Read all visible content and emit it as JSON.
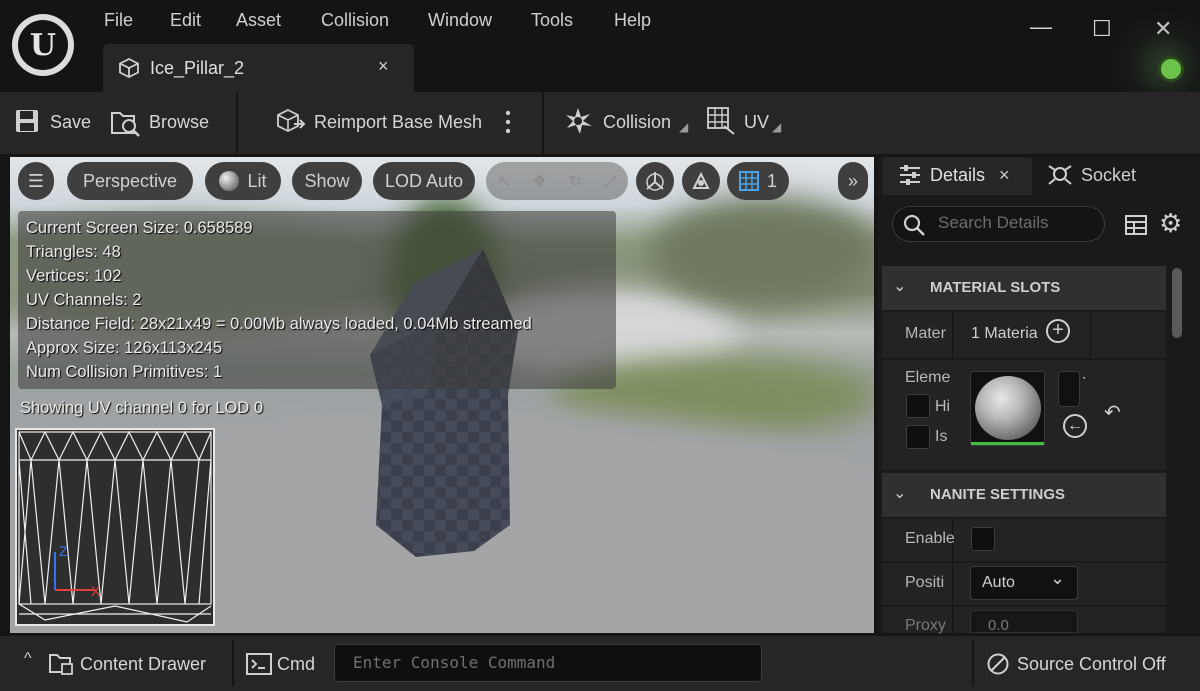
{
  "menu": [
    "File",
    "Edit",
    "Asset",
    "Collision",
    "Window",
    "Tools",
    "Help"
  ],
  "tab": {
    "title": "Ice_Pillar_2",
    "close": "×"
  },
  "window_controls": {
    "minimize": "—",
    "maximize": "☐",
    "close": "✕"
  },
  "toolbar": {
    "save": "Save",
    "browse": "Browse",
    "reimport": "Reimport Base Mesh",
    "collision": "Collision",
    "uv": "UV"
  },
  "viewport": {
    "buttons": {
      "menu": "☰",
      "perspective": "Perspective",
      "lit": "Lit",
      "show": "Show",
      "lod": "LOD Auto",
      "grid_value": "1",
      "more": "»"
    },
    "stats": [
      "Current Screen Size:  0.658589",
      "Triangles:  48",
      "Vertices:  102",
      "UV Channels:  2",
      "Distance Field:  28x21x49 = 0.00Mb always loaded, 0.04Mb streamed",
      "Approx Size:  126x113x245",
      "Num Collision Primitives:  1"
    ],
    "uv_caption": "Showing UV channel 0 for LOD 0"
  },
  "details": {
    "tab_details": "Details",
    "tab_close": "×",
    "tab_socket": "Socket",
    "search_placeholder": "Search Details",
    "material_slots": {
      "title": "MATERIAL SLOTS",
      "row_label": "Mater",
      "row_value": "1 Materia",
      "element_label": "Eleme",
      "hi_label": "Hi",
      "is_label": "Is"
    },
    "nanite": {
      "title": "NANITE SETTINGS",
      "enable_label": "Enable",
      "position_label": "Positi",
      "position_value": "Auto",
      "proxy_label": "Proxy",
      "proxy_value": "0.0"
    }
  },
  "statusbar": {
    "content_drawer": "Content Drawer",
    "cmd": "Cmd",
    "console_placeholder": "Enter Console Command",
    "source_control": "Source Control Off"
  }
}
